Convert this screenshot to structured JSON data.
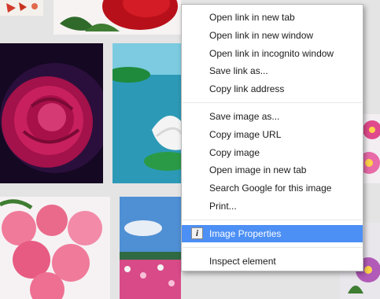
{
  "context_menu": {
    "groups": [
      [
        "Open link in new tab",
        "Open link in new window",
        "Open link in incognito window",
        "Save link as...",
        "Copy link address"
      ],
      [
        "Save image as...",
        "Copy image URL",
        "Copy image",
        "Open image in new tab",
        "Search Google for this image",
        "Print..."
      ],
      [
        "Image Properties"
      ],
      [
        "Inspect element"
      ]
    ],
    "highlighted": "Image Properties",
    "highlighted_icon": "info-icon",
    "highlight_color": "#4c8ff5"
  },
  "thumbnails": [
    {
      "name": "thumb-butterflies",
      "icon": "butterfly-image"
    },
    {
      "name": "thumb-red-rose-top",
      "icon": "rose-image"
    },
    {
      "name": "thumb-pink-rose-dew",
      "icon": "rose-image"
    },
    {
      "name": "thumb-lotus-pond",
      "icon": "lotus-image"
    },
    {
      "name": "thumb-pink-flower-right",
      "icon": "flower-image"
    },
    {
      "name": "thumb-pink-roses-bouquet",
      "icon": "roses-image"
    },
    {
      "name": "thumb-flower-field",
      "icon": "field-image"
    },
    {
      "name": "thumb-purple-flower-right",
      "icon": "flower-image"
    }
  ]
}
